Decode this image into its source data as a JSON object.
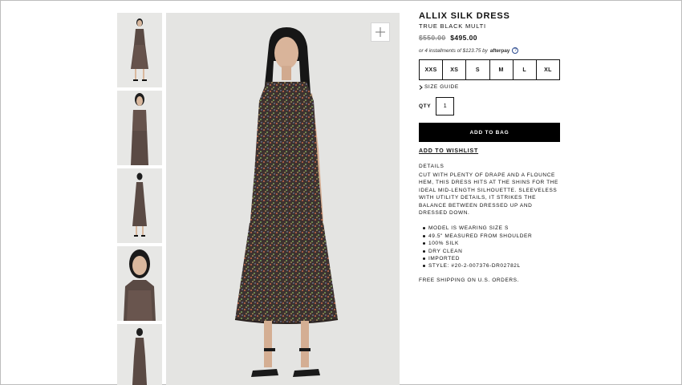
{
  "product": {
    "title": "ALLIX SILK DRESS",
    "color": "TRUE BLACK MULTI",
    "old_price": "$550.00",
    "price": "$495.00",
    "installments": "or 4 installments of $123.75 by",
    "afterpay_logo": "afterpay",
    "help_icon": "?"
  },
  "sizes": [
    "XXS",
    "XS",
    "S",
    "M",
    "L",
    "XL"
  ],
  "size_guide": "SIZE GUIDE",
  "qty": {
    "label": "QTY",
    "value": "1"
  },
  "add_to_bag": "ADD TO BAG",
  "add_to_wishlist": "ADD TO WISHLIST",
  "details": {
    "heading": "DETAILS",
    "body": "CUT WITH PLENTY OF DRAPE AND A FLOUNCE HEM, THIS DRESS HITS AT THE SHINS FOR THE IDEAL MID-LENGTH SILHOUETTE. SLEEVELESS WITH UTILITY DETAILS, IT STRIKES THE BALANCE BETWEEN DRESSED UP AND DRESSED DOWN.",
    "bullets": [
      "MODEL IS WEARING SIZE S",
      "49.5\" MEASURED FROM SHOULDER",
      "100% SILK",
      "DRY CLEAN",
      "IMPORTED",
      "STYLE: #20-2-007376-DR02782L"
    ]
  },
  "shipping": "FREE SHIPPING ON U.S. ORDERS.",
  "icons": {
    "zoom": "plus-icon",
    "size_guide_arrow": "chevron-right-icon"
  },
  "colors": {
    "primary": "#000000",
    "background": "#ffffff",
    "photo_bg": "#e4e4e2",
    "afterpay_accent": "#2b4a8f"
  }
}
